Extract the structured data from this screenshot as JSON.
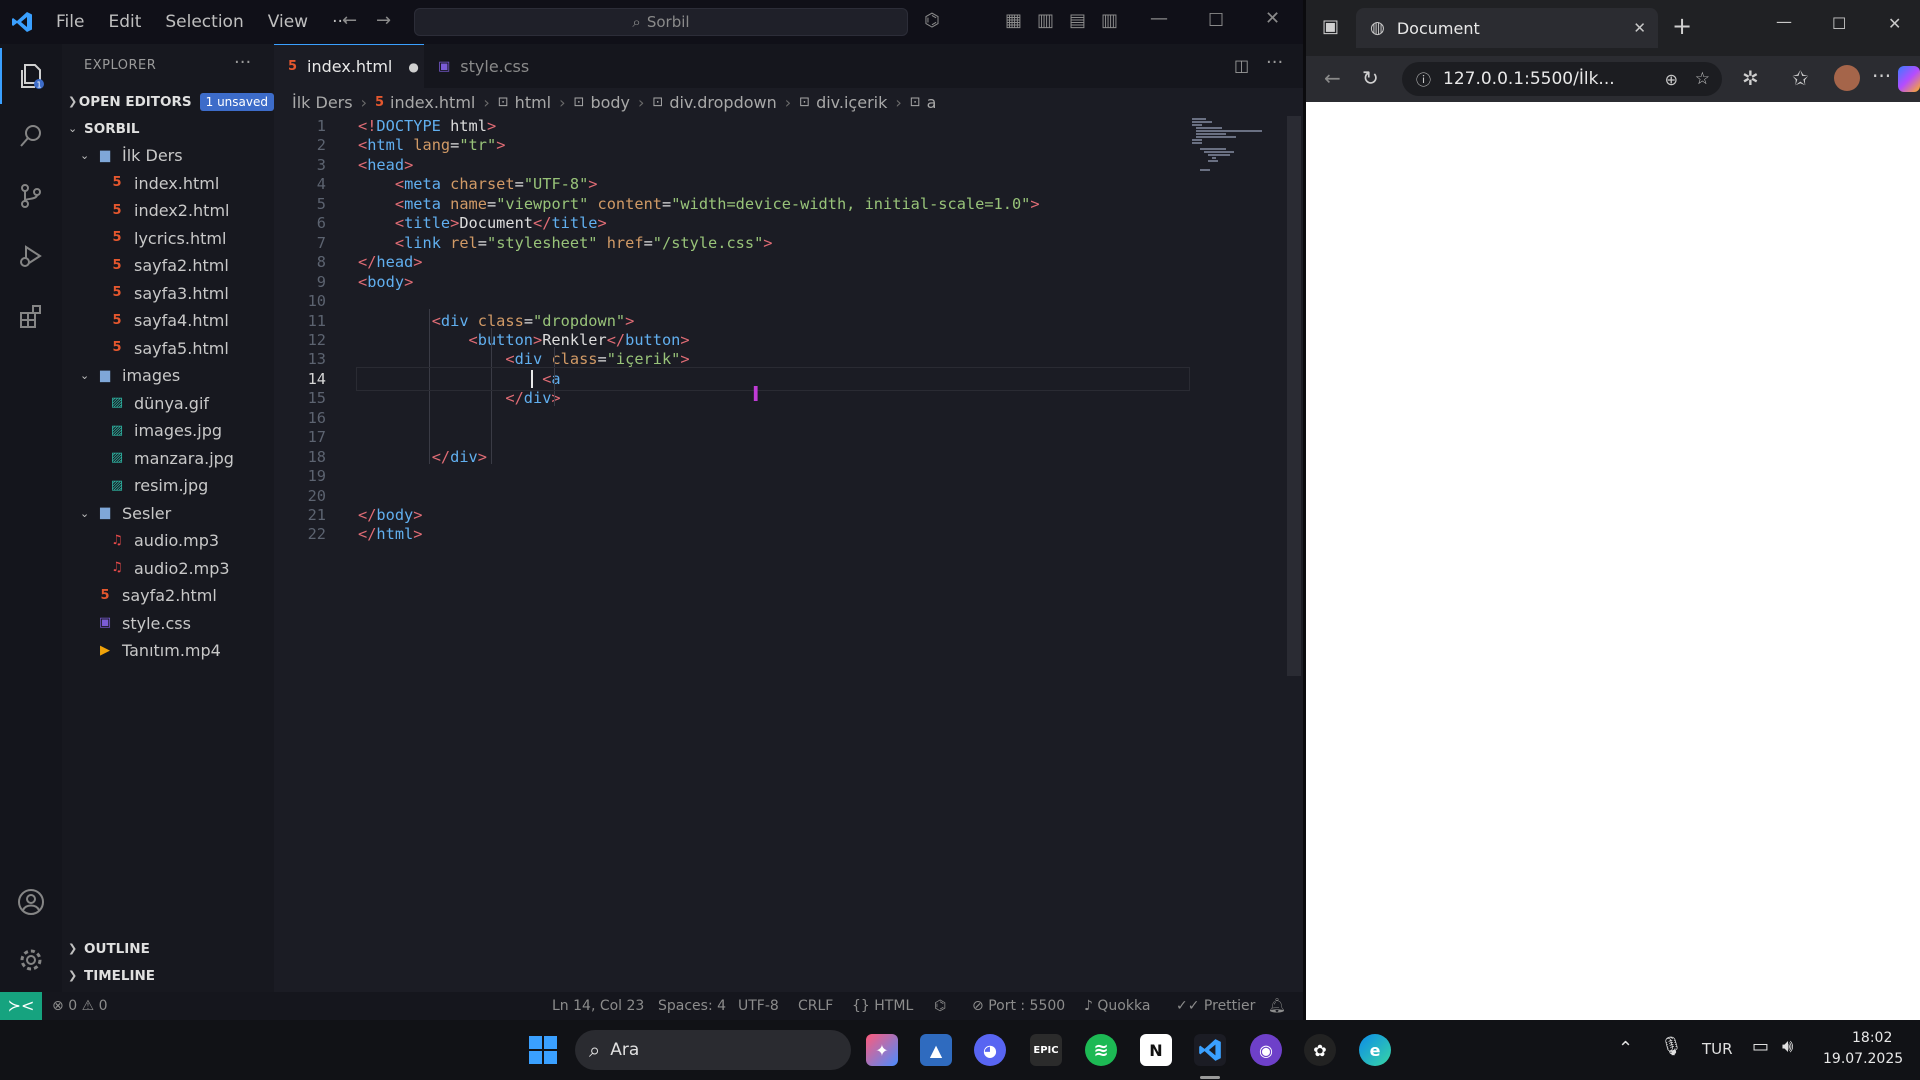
{
  "titlebar": {
    "menu": [
      "File",
      "Edit",
      "Selection",
      "View",
      "···"
    ],
    "search_placeholder": "Sorbil"
  },
  "explorer": {
    "title": "EXPLORER",
    "open_editors": "OPEN EDITORS",
    "unsaved_badge": "1 unsaved",
    "root": "SORBIL",
    "tree": [
      {
        "label": "İlk Ders",
        "type": "folder",
        "indent": 1
      },
      {
        "label": "index.html",
        "type": "html",
        "indent": 2
      },
      {
        "label": "index2.html",
        "type": "html",
        "indent": 2
      },
      {
        "label": "lycrics.html",
        "type": "html",
        "indent": 2
      },
      {
        "label": "sayfa2.html",
        "type": "html",
        "indent": 2
      },
      {
        "label": "sayfa3.html",
        "type": "html",
        "indent": 2
      },
      {
        "label": "sayfa4.html",
        "type": "html",
        "indent": 2
      },
      {
        "label": "sayfa5.html",
        "type": "html",
        "indent": 2
      },
      {
        "label": "images",
        "type": "folder",
        "indent": 1
      },
      {
        "label": "dünya.gif",
        "type": "img",
        "indent": 2
      },
      {
        "label": "images.jpg",
        "type": "img",
        "indent": 2
      },
      {
        "label": "manzara.jpg",
        "type": "img",
        "indent": 2
      },
      {
        "label": "resim.jpg",
        "type": "img",
        "indent": 2
      },
      {
        "label": "Sesler",
        "type": "folder",
        "indent": 1
      },
      {
        "label": "audio.mp3",
        "type": "aud",
        "indent": 2
      },
      {
        "label": "audio2.mp3",
        "type": "aud",
        "indent": 2
      },
      {
        "label": "sayfa2.html",
        "type": "html",
        "indent": 1
      },
      {
        "label": "style.css",
        "type": "css",
        "indent": 1
      },
      {
        "label": "Tanıtım.mp4",
        "type": "vid",
        "indent": 1
      }
    ],
    "outline": "OUTLINE",
    "timeline": "TIMELINE"
  },
  "editor": {
    "tabs": [
      {
        "label": "index.html",
        "active": true,
        "dirty": true
      },
      {
        "label": "style.css",
        "active": false,
        "dirty": false
      }
    ],
    "breadcrumb": [
      "İlk Ders",
      "index.html",
      "html",
      "body",
      "div.dropdown",
      "div.içerik",
      "a"
    ],
    "current_line": 14,
    "lines": [
      [
        {
          "t": "tag",
          "v": "<!"
        },
        {
          "t": "name",
          "v": "DOCTYPE"
        },
        {
          "t": "txt",
          "v": " html"
        },
        {
          "t": "tag",
          "v": ">"
        }
      ],
      [
        {
          "t": "tag",
          "v": "<"
        },
        {
          "t": "name",
          "v": "html"
        },
        {
          "t": "txt",
          "v": " "
        },
        {
          "t": "attr",
          "v": "lang"
        },
        {
          "t": "txt",
          "v": "="
        },
        {
          "t": "str",
          "v": "\"tr\""
        },
        {
          "t": "tag",
          "v": ">"
        }
      ],
      [
        {
          "t": "tag",
          "v": "<"
        },
        {
          "t": "name",
          "v": "head"
        },
        {
          "t": "tag",
          "v": ">"
        }
      ],
      [
        {
          "t": "txt",
          "v": "    "
        },
        {
          "t": "tag",
          "v": "<"
        },
        {
          "t": "name",
          "v": "meta"
        },
        {
          "t": "txt",
          "v": " "
        },
        {
          "t": "attr",
          "v": "charset"
        },
        {
          "t": "txt",
          "v": "="
        },
        {
          "t": "str",
          "v": "\"UTF-8\""
        },
        {
          "t": "tag",
          "v": ">"
        }
      ],
      [
        {
          "t": "txt",
          "v": "    "
        },
        {
          "t": "tag",
          "v": "<"
        },
        {
          "t": "name",
          "v": "meta"
        },
        {
          "t": "txt",
          "v": " "
        },
        {
          "t": "attr",
          "v": "name"
        },
        {
          "t": "txt",
          "v": "="
        },
        {
          "t": "str",
          "v": "\"viewport\""
        },
        {
          "t": "txt",
          "v": " "
        },
        {
          "t": "attr",
          "v": "content"
        },
        {
          "t": "txt",
          "v": "="
        },
        {
          "t": "str",
          "v": "\"width=device-width, initial-scale=1.0\""
        },
        {
          "t": "tag",
          "v": ">"
        }
      ],
      [
        {
          "t": "txt",
          "v": "    "
        },
        {
          "t": "tag",
          "v": "<"
        },
        {
          "t": "name",
          "v": "title"
        },
        {
          "t": "tag",
          "v": ">"
        },
        {
          "t": "txt",
          "v": "Document"
        },
        {
          "t": "tag",
          "v": "</"
        },
        {
          "t": "name",
          "v": "title"
        },
        {
          "t": "tag",
          "v": ">"
        }
      ],
      [
        {
          "t": "txt",
          "v": "    "
        },
        {
          "t": "tag",
          "v": "<"
        },
        {
          "t": "name",
          "v": "link"
        },
        {
          "t": "txt",
          "v": " "
        },
        {
          "t": "attr",
          "v": "rel"
        },
        {
          "t": "txt",
          "v": "="
        },
        {
          "t": "str",
          "v": "\"stylesheet\""
        },
        {
          "t": "txt",
          "v": " "
        },
        {
          "t": "attr",
          "v": "href"
        },
        {
          "t": "txt",
          "v": "="
        },
        {
          "t": "str",
          "v": "\"/style.css\""
        },
        {
          "t": "tag",
          "v": ">"
        }
      ],
      [
        {
          "t": "tag",
          "v": "</"
        },
        {
          "t": "name",
          "v": "head"
        },
        {
          "t": "tag",
          "v": ">"
        }
      ],
      [
        {
          "t": "tag",
          "v": "<"
        },
        {
          "t": "name",
          "v": "body"
        },
        {
          "t": "tag",
          "v": ">"
        }
      ],
      [],
      [
        {
          "t": "txt",
          "v": "        "
        },
        {
          "t": "tag",
          "v": "<"
        },
        {
          "t": "name",
          "v": "div"
        },
        {
          "t": "txt",
          "v": " "
        },
        {
          "t": "attr",
          "v": "class"
        },
        {
          "t": "txt",
          "v": "="
        },
        {
          "t": "str",
          "v": "\"dropdown\""
        },
        {
          "t": "tag",
          "v": ">"
        }
      ],
      [
        {
          "t": "txt",
          "v": "            "
        },
        {
          "t": "tag",
          "v": "<"
        },
        {
          "t": "name",
          "v": "button"
        },
        {
          "t": "tag",
          "v": ">"
        },
        {
          "t": "txt",
          "v": "Renkler"
        },
        {
          "t": "tag",
          "v": "</"
        },
        {
          "t": "name",
          "v": "button"
        },
        {
          "t": "tag",
          "v": ">"
        }
      ],
      [
        {
          "t": "txt",
          "v": "                "
        },
        {
          "t": "tag",
          "v": "<"
        },
        {
          "t": "name",
          "v": "div"
        },
        {
          "t": "txt",
          "v": " "
        },
        {
          "t": "attr",
          "v": "class"
        },
        {
          "t": "txt",
          "v": "="
        },
        {
          "t": "str",
          "v": "\"içerik\""
        },
        {
          "t": "tag",
          "v": ">"
        }
      ],
      [
        {
          "t": "txt",
          "v": "                    "
        },
        {
          "t": "tag",
          "v": "<"
        },
        {
          "t": "name",
          "v": "a"
        }
      ],
      [
        {
          "t": "txt",
          "v": "                "
        },
        {
          "t": "tag",
          "v": "</"
        },
        {
          "t": "name",
          "v": "div"
        },
        {
          "t": "tag",
          "v": ">"
        }
      ],
      [],
      [],
      [
        {
          "t": "txt",
          "v": "        "
        },
        {
          "t": "tag",
          "v": "</"
        },
        {
          "t": "name",
          "v": "div"
        },
        {
          "t": "tag",
          "v": ">"
        }
      ],
      [],
      [],
      [
        {
          "t": "tag",
          "v": "</"
        },
        {
          "t": "name",
          "v": "body"
        },
        {
          "t": "tag",
          "v": ">"
        }
      ],
      [
        {
          "t": "tag",
          "v": "</"
        },
        {
          "t": "name",
          "v": "html"
        },
        {
          "t": "tag",
          "v": ">"
        }
      ]
    ]
  },
  "statusbar": {
    "errors": "0",
    "warnings": "0",
    "position": "Ln 14, Col 23",
    "spaces": "Spaces: 4",
    "encoding": "UTF-8",
    "eol": "CRLF",
    "language": "HTML",
    "port": "Port : 5500",
    "quokka": "Quokka",
    "prettier": "Prettier"
  },
  "browser": {
    "tab_title": "Document",
    "url": "127.0.0.1:5500/İlk..."
  },
  "taskbar": {
    "search_label": "Ara",
    "lang": "TUR",
    "time": "18:02",
    "date": "19.07.2025"
  },
  "colors": {
    "accent": "#3aa0ff",
    "remote_badge": "#16a37f",
    "unsaved_badge": "#3d6cc9"
  }
}
